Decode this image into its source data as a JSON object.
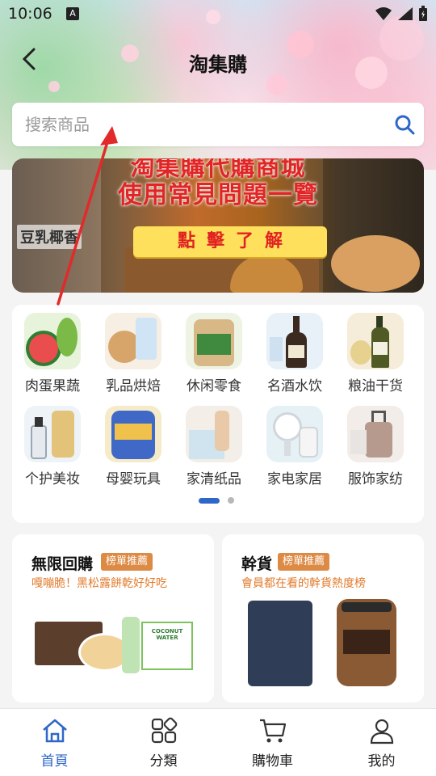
{
  "status_bar": {
    "time": "10:06",
    "notification_letter": "A"
  },
  "header": {
    "title": "淘集購"
  },
  "search": {
    "placeholder": "搜索商品"
  },
  "banner": {
    "headline_top": "淘集購代購商城",
    "headline": "使用常見問題一覽",
    "cta": "點擊了解",
    "side_text": "豆乳椰香"
  },
  "categories": [
    {
      "label": "肉蛋果蔬",
      "icon": "fruit-vegetable-icon"
    },
    {
      "label": "乳品烘焙",
      "icon": "dairy-bakery-icon"
    },
    {
      "label": "休闲零食",
      "icon": "snack-icon"
    },
    {
      "label": "名酒水饮",
      "icon": "wine-icon"
    },
    {
      "label": "粮油干货",
      "icon": "oil-icon"
    },
    {
      "label": "个护美妆",
      "icon": "cosmetics-icon"
    },
    {
      "label": "母婴玩具",
      "icon": "baby-formula-icon"
    },
    {
      "label": "家清纸品",
      "icon": "tissue-icon"
    },
    {
      "label": "家电家居",
      "icon": "appliance-icon"
    },
    {
      "label": "服饰家纺",
      "icon": "luggage-icon"
    }
  ],
  "carousel": {
    "page_count": 2,
    "active_page": 1
  },
  "promos": [
    {
      "title": "無限回購",
      "badge": "榜單推薦",
      "subtitle": "嘎嘣脆！黑松露餅乾好好吃",
      "product_text": "COCONUT WATER"
    },
    {
      "title": "幹貨",
      "badge": "榜單推薦",
      "subtitle": "會員都在看的幹貨熱度榜"
    }
  ],
  "bottom_nav": [
    {
      "label": "首頁",
      "icon": "home-icon",
      "active": true
    },
    {
      "label": "分類",
      "icon": "category-icon",
      "active": false
    },
    {
      "label": "購物車",
      "icon": "cart-icon",
      "active": false
    },
    {
      "label": "我的",
      "icon": "profile-icon",
      "active": false
    }
  ],
  "colors": {
    "accent": "#2f67c8",
    "badge": "#dd8a45",
    "promo_sub": "#e27a2b",
    "banner_red": "#e12525",
    "banner_cta": "#ffe05c"
  }
}
